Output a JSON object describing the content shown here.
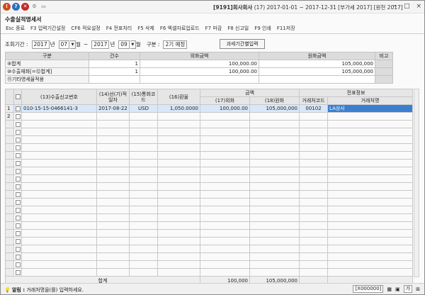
{
  "titlebar": {
    "icons": [
      {
        "name": "exclamation-icon",
        "glyph": "!",
        "color": "#d04a1c"
      },
      {
        "name": "help-icon",
        "glyph": "?",
        "color": "#2f6fc0"
      },
      {
        "name": "close-circle-icon",
        "glyph": "✕",
        "color": "#c02a2a"
      },
      {
        "name": "settings-icon",
        "glyph": "⚙",
        "color": "#777777"
      },
      {
        "name": "window-icon",
        "glyph": "▭",
        "color": "#555555"
      }
    ],
    "company": "[9191]회사회사",
    "period": "(17) 2017-01-01 ~ 2017-12-31",
    "tax_type": "[부가세 2017]",
    "office": "[원천 2017]",
    "controls": [
      "−",
      "□",
      "×"
    ]
  },
  "page_title": "수출실적명세서",
  "function_keys": [
    "Esc 종료",
    "F3 입력기간설정",
    "CF6 적요설정",
    "F4 전표처리",
    "F5 삭제",
    "F6 엑셀자료업로드",
    "F7 마감",
    "F8 신고일",
    "F9 인쇄",
    "F11저장"
  ],
  "filter": {
    "label": "조회기간 :",
    "from_year": "2017",
    "year_unit": "년",
    "from_month": "07",
    "month_unit": "월",
    "tilde": "~",
    "to_year": "2017",
    "to_month": "09",
    "division_label": "구분 :",
    "division_value": "2기 예정",
    "tax_button": "과세기간별입력"
  },
  "summary": {
    "headers": [
      "구분",
      "건수",
      "외화금액",
      "원화금액",
      "비고"
    ],
    "rows": [
      {
        "label": "⑨합계",
        "count": "1",
        "foreign": "100,000.00",
        "krw": "105,000,000"
      },
      {
        "label": "⑩수출재화[=⑫합계]",
        "count": "1",
        "foreign": "100,000.00",
        "krw": "105,000,000"
      },
      {
        "label": "⑪기타영세율적용",
        "count": "",
        "foreign": "",
        "krw": ""
      }
    ]
  },
  "grid": {
    "headers": {
      "report_no": "(13)수출신고번호",
      "ship_date": "(14)선(기)적일자",
      "currency": "(15)통화코드",
      "rate": "(16)환율",
      "amount_group": "금액",
      "foreign": "(17)외화",
      "krw": "(18)원화",
      "slip_group": "전표정보",
      "client_code": "거래처코드",
      "client_name": "거래처명"
    },
    "rows": [
      {
        "no": "1",
        "report_no": "010-15-15-0466141-3",
        "ship_date": "2017-08-22",
        "currency": "USD",
        "rate": "1,050.0000",
        "foreign": "100,000.00",
        "krw": "105,000,000",
        "client_code": "00102",
        "client_name": "LA상사"
      },
      {
        "no": "2",
        "report_no": "",
        "ship_date": "",
        "currency": "",
        "rate": "",
        "foreign": "",
        "krw": "",
        "client_code": "",
        "client_name": ""
      }
    ],
    "empty_row_count": 20,
    "total_label": "합계",
    "total_foreign": "100,000",
    "total_krw": "105,000,000"
  },
  "statusbar": {
    "label": "알림 :",
    "message": "거래처명을(를) 입력하세요.",
    "right_code": "[X000000]",
    "buttons": [
      "가",
      "⊞"
    ]
  }
}
